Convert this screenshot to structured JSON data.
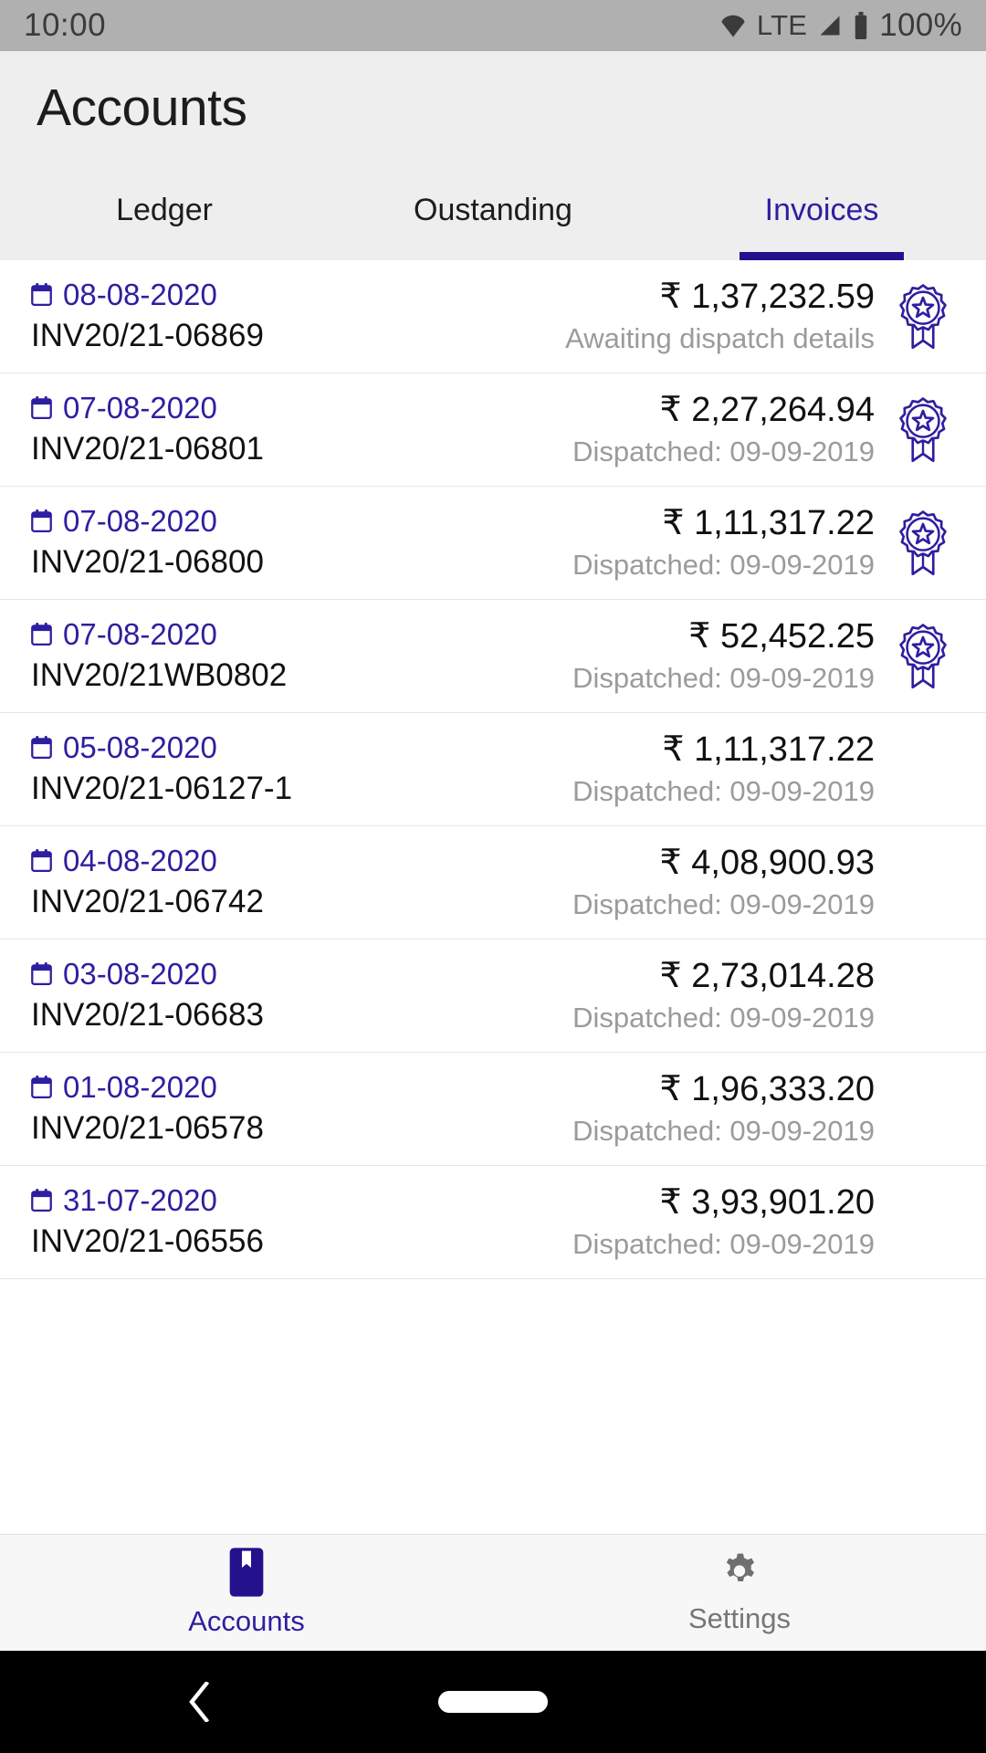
{
  "status_bar": {
    "time": "10:00",
    "network_label": "LTE",
    "battery_percent": "100%",
    "icons": [
      "wifi-icon",
      "signal-icon",
      "battery-icon"
    ]
  },
  "app_bar": {
    "title": "Accounts",
    "tabs": [
      {
        "label": "Ledger",
        "active": false
      },
      {
        "label": "Oustanding",
        "active": false
      },
      {
        "label": "Invoices",
        "active": true
      }
    ]
  },
  "colors": {
    "accent": "#2d1fa0",
    "indicator": "#23128c",
    "status_bar_bg": "#b0b0b0",
    "app_bar_bg": "#eeeeee",
    "muted_text": "#9b9b9b",
    "primary_text": "#111111"
  },
  "invoices": [
    {
      "date": "08-08-2020",
      "invoice_no": "INV20/21-06869",
      "amount": "₹ 1,37,232.59",
      "status": "Awaiting dispatch details",
      "badge": true
    },
    {
      "date": "07-08-2020",
      "invoice_no": "INV20/21-06801",
      "amount": "₹ 2,27,264.94",
      "status": "Dispatched: 09-09-2019",
      "badge": true
    },
    {
      "date": "07-08-2020",
      "invoice_no": "INV20/21-06800",
      "amount": "₹ 1,11,317.22",
      "status": "Dispatched: 09-09-2019",
      "badge": true
    },
    {
      "date": "07-08-2020",
      "invoice_no": "INV20/21WB0802",
      "amount": "₹ 52,452.25",
      "status": "Dispatched: 09-09-2019",
      "badge": true
    },
    {
      "date": "05-08-2020",
      "invoice_no": "INV20/21-06127-1",
      "amount": "₹ 1,11,317.22",
      "status": "Dispatched: 09-09-2019",
      "badge": false
    },
    {
      "date": "04-08-2020",
      "invoice_no": "INV20/21-06742",
      "amount": "₹ 4,08,900.93",
      "status": "Dispatched: 09-09-2019",
      "badge": false
    },
    {
      "date": "03-08-2020",
      "invoice_no": "INV20/21-06683",
      "amount": "₹ 2,73,014.28",
      "status": "Dispatched: 09-09-2019",
      "badge": false
    },
    {
      "date": "01-08-2020",
      "invoice_no": "INV20/21-06578",
      "amount": "₹ 1,96,333.20",
      "status": "Dispatched: 09-09-2019",
      "badge": false
    },
    {
      "date": "31-07-2020",
      "invoice_no": "INV20/21-06556",
      "amount": "₹ 3,93,901.20",
      "status": "Dispatched: 09-09-2019",
      "badge": false
    }
  ],
  "bottom_nav": [
    {
      "label": "Accounts",
      "icon": "book-icon",
      "active": true
    },
    {
      "label": "Settings",
      "icon": "gear-icon",
      "active": false
    }
  ],
  "system_nav": {
    "back": "back-chevron-icon",
    "home": "home-pill-indicator"
  }
}
